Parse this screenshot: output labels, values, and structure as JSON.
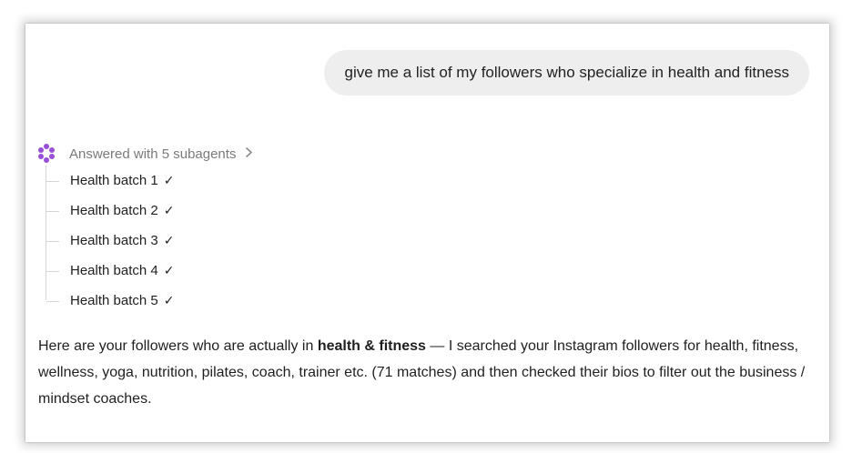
{
  "user_message": "give me a list of my followers who specialize in health and fitness",
  "subagents": {
    "header": "Answered with 5 subagents",
    "chevron_icon": "chevron-right-icon",
    "items": [
      {
        "label": "Health batch 1",
        "check": "✓"
      },
      {
        "label": "Health batch 2",
        "check": "✓"
      },
      {
        "label": "Health batch 3",
        "check": "✓"
      },
      {
        "label": "Health batch 4",
        "check": "✓"
      },
      {
        "label": "Health batch 5",
        "check": "✓"
      }
    ]
  },
  "answer": {
    "part1": "Here are your followers who are actually in ",
    "bold": "health & fitness",
    "part2": " — I searched your Instagram followers for health, fitness, wellness, yoga, nutrition, pilates, coach, trainer etc. (71 matches) and then checked their bios to filter out the business / mindset coaches."
  },
  "colors": {
    "accent_icon": "#9a4fd9",
    "bubble_bg": "#eeeeee"
  }
}
